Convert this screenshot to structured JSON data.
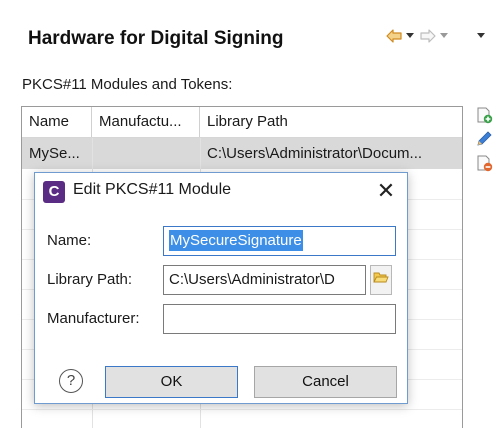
{
  "page": {
    "title": "Hardware for Digital Signing",
    "section_label": "PKCS#11 Modules and Tokens:"
  },
  "nav_icons": [
    "back-arrow-icon",
    "back-menu-icon",
    "forward-arrow-icon",
    "forward-menu-icon",
    "view-menu-icon"
  ],
  "table": {
    "columns": [
      "Name",
      "Manufactu...",
      "Library Path"
    ],
    "rows": [
      {
        "name": "MySe...",
        "manufacturer": "",
        "library_path": "C:\\Users\\Administrator\\Docum..."
      }
    ]
  },
  "tools": [
    "add-icon",
    "edit-icon",
    "remove-icon"
  ],
  "dialog": {
    "title": "Edit PKCS#11 Module",
    "app_icon_letter": "C",
    "close_glyph": "✕",
    "name_label": "Name:",
    "name_value": "MySecureSignature",
    "library_label": "Library Path:",
    "library_value": "C:\\Users\\Administrator\\D",
    "manufacturer_label": "Manufacturer:",
    "manufacturer_value": "",
    "help_glyph": "?",
    "ok_label": "OK",
    "cancel_label": "Cancel"
  },
  "colors": {
    "accent": "#3c78c8",
    "selection": "#3d8ee6",
    "app_icon": "#5b2c83",
    "nav_arrow": "#e0a040",
    "row_selected": "#d9d9d9"
  }
}
